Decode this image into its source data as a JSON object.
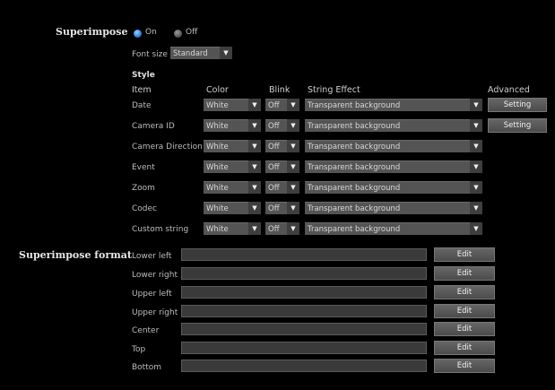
{
  "superimpose": {
    "title": "Superimpose",
    "on_label": "On",
    "off_label": "Off",
    "selected": "On"
  },
  "font_size": {
    "label": "Font size",
    "value": "Standard"
  },
  "style": {
    "title": "Style",
    "headers": {
      "item": "Item",
      "color": "Color",
      "blink": "Blink",
      "string_effect": "String Effect",
      "advanced": "Advanced"
    },
    "rows": [
      {
        "item": "Date",
        "color": "White",
        "blink": "Off",
        "effect": "Transparent background",
        "advanced": "Setting"
      },
      {
        "item": "Camera ID",
        "color": "White",
        "blink": "Off",
        "effect": "Transparent background",
        "advanced": "Setting"
      },
      {
        "item": "Camera Direction",
        "color": "White",
        "blink": "Off",
        "effect": "Transparent background"
      },
      {
        "item": "Event",
        "color": "White",
        "blink": "Off",
        "effect": "Transparent background"
      },
      {
        "item": "Zoom",
        "color": "White",
        "blink": "Off",
        "effect": "Transparent background"
      },
      {
        "item": "Codec",
        "color": "White",
        "blink": "Off",
        "effect": "Transparent background"
      },
      {
        "item": "Custom string",
        "color": "White",
        "blink": "Off",
        "effect": "Transparent background"
      }
    ]
  },
  "format": {
    "title": "Superimpose format",
    "edit_label": "Edit",
    "rows": [
      {
        "label": "Lower left",
        "value": ""
      },
      {
        "label": "Lower right",
        "value": ""
      },
      {
        "label": "Upper left",
        "value": ""
      },
      {
        "label": "Upper right",
        "value": ""
      },
      {
        "label": "Center",
        "value": ""
      },
      {
        "label": "Top",
        "value": ""
      },
      {
        "label": "Bottom",
        "value": ""
      }
    ]
  },
  "icons": {
    "dropdown": "chevron-down-icon",
    "radio_on": "radio-selected-icon",
    "radio_off": "radio-unselected-icon"
  },
  "colors": {
    "background": "#000000",
    "radio_on": "#2a7fe0",
    "control": "#545454"
  }
}
